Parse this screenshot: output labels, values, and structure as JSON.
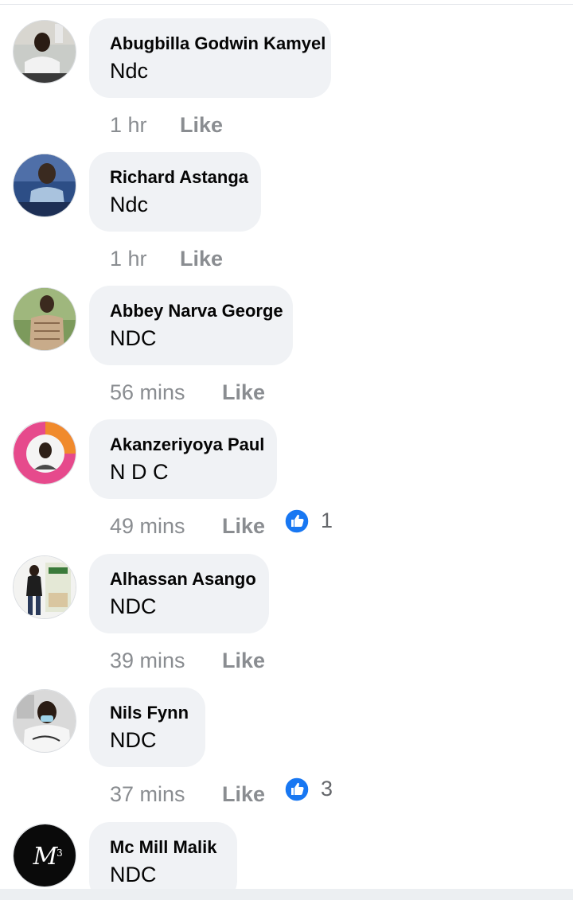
{
  "comments": [
    {
      "author": "Abugbilla Godwin Kamyel",
      "text": "Ndc",
      "time": "1 hr",
      "like_label": "Like",
      "reactions": null
    },
    {
      "author": "Richard Astanga",
      "text": "Ndc",
      "time": "1 hr",
      "like_label": "Like",
      "reactions": null
    },
    {
      "author": "Abbey Narva George",
      "text": "NDC",
      "time": "56 mins",
      "like_label": "Like",
      "reactions": null
    },
    {
      "author": "Akanzeriyoya Paul",
      "text": "N D C",
      "time": "49 mins",
      "like_label": "Like",
      "reactions": "1"
    },
    {
      "author": "Alhassan Asango",
      "text": "NDC",
      "time": "39 mins",
      "like_label": "Like",
      "reactions": null
    },
    {
      "author": "Nils Fynn",
      "text": "NDC",
      "time": "37 mins",
      "like_label": "Like",
      "reactions": "3"
    },
    {
      "author": "Mc Mill Malik",
      "text": "NDC",
      "time": null,
      "like_label": null,
      "reactions": null
    }
  ],
  "colors": {
    "like_blue": "#1877f2",
    "meta_gray": "#8a8d91",
    "bubble_bg": "#f0f2f5"
  },
  "icons": {
    "reaction": "thumbs-up-icon"
  }
}
